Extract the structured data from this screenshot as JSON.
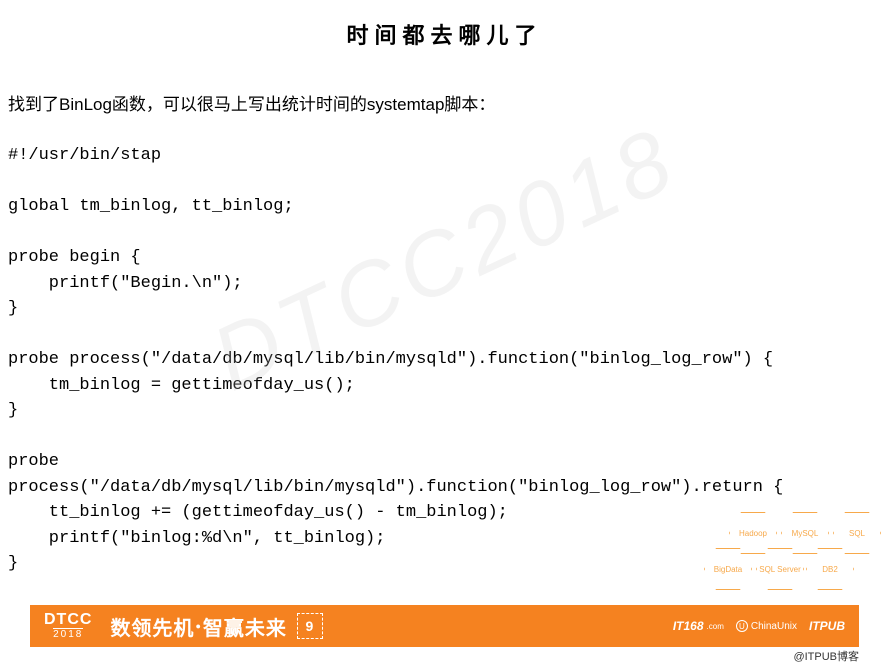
{
  "title": "时间都去哪儿了",
  "intro": "找到了BinLog函数，可以很马上写出统计时间的systemtap脚本：",
  "code": "#!/usr/bin/stap\n\nglobal tm_binlog, tt_binlog;\n\nprobe begin {\n    printf(\"Begin.\\n\");\n}\n\nprobe process(\"/data/db/mysql/lib/bin/mysqld\").function(\"binlog_log_row\") {\n    tm_binlog = gettimeofday_us();\n}\n\nprobe\nprocess(\"/data/db/mysql/lib/bin/mysqld\").function(\"binlog_log_row\").return {\n    tt_binlog += (gettimeofday_us() - tm_binlog);\n    printf(\"binlog:%d\\n\", tt_binlog);\n}",
  "watermark": "DTCC2018",
  "hex_labels": {
    "hadoop": "Hadoop",
    "mysql": "MySQL",
    "sql": "SQL",
    "bigdata": "BigData",
    "db2": "DB2",
    "sqlserver": "SQL Server"
  },
  "footer": {
    "logo_dtcc": "DTCC",
    "logo_year": "2018",
    "slogan_part1": "数领先机",
    "slogan_sup": "●",
    "slogan_part2": "智赢未来",
    "icon_9": "9",
    "brands": {
      "it168": "IT168",
      "it168_suffix": ".com",
      "chinaunix_icon": "U",
      "chinaunix": "ChinaUnix",
      "itpub": "ITPUB"
    }
  },
  "attribution": "@ITPUB博客"
}
